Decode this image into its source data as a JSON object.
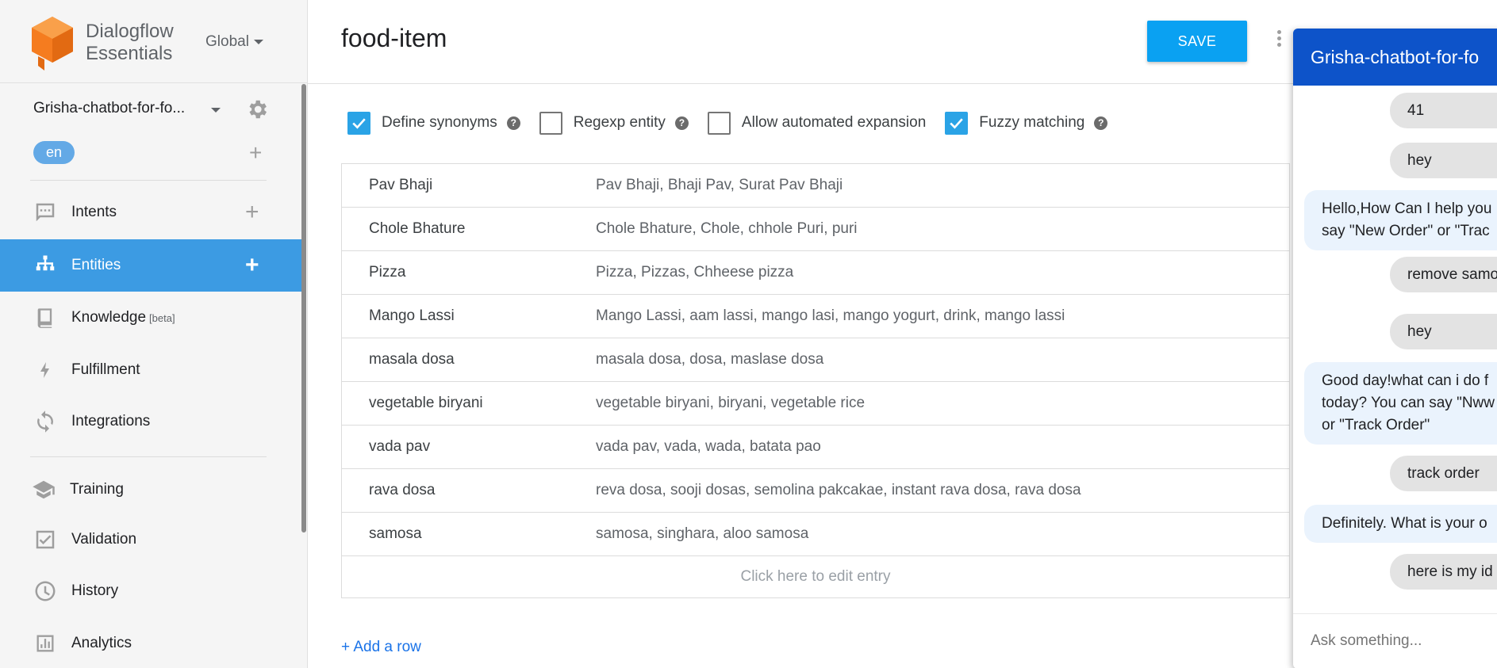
{
  "brand": {
    "name_line1": "Dialogflow",
    "name_line2": "Essentials",
    "region": "Global"
  },
  "agent": {
    "name": "Grisha-chatbot-for-fo...",
    "language": "en"
  },
  "nav": {
    "intents": "Intents",
    "entities": "Entities",
    "knowledge": "Knowledge",
    "knowledge_badge": "[beta]",
    "fulfillment": "Fulfillment",
    "integrations": "Integrations",
    "training": "Training",
    "validation": "Validation",
    "history": "History",
    "analytics": "Analytics"
  },
  "entity": {
    "title": "food-item",
    "save_label": "SAVE",
    "options": {
      "define_synonyms": {
        "label": "Define synonyms",
        "checked": true
      },
      "regexp_entity": {
        "label": "Regexp entity",
        "checked": false
      },
      "automated_expansion": {
        "label": "Allow automated expansion",
        "checked": false
      },
      "fuzzy_matching": {
        "label": "Fuzzy matching",
        "checked": true
      }
    },
    "rows": [
      {
        "value": "Pav Bhaji",
        "synonyms": "Pav Bhaji, Bhaji Pav, Surat Pav Bhaji"
      },
      {
        "value": "Chole Bhature",
        "synonyms": "Chole Bhature, Chole, chhole Puri, puri"
      },
      {
        "value": "Pizza",
        "synonyms": "Pizza, Pizzas, Chheese pizza"
      },
      {
        "value": "Mango Lassi",
        "synonyms": "Mango Lassi, aam lassi, mango lasi, mango yogurt, drink, mango lassi"
      },
      {
        "value": "masala dosa",
        "synonyms": "masala dosa, dosa, maslase dosa"
      },
      {
        "value": "vegetable biryani",
        "synonyms": "vegetable biryani, biryani, vegetable rice"
      },
      {
        "value": "vada pav",
        "synonyms": "vada pav, vada, wada, batata pao"
      },
      {
        "value": "rava dosa",
        "synonyms": "reva dosa, sooji dosas, semolina pakcakae, instant rava dosa, rava dosa"
      },
      {
        "value": "samosa",
        "synonyms": "samosa, singhara, aloo samosa"
      }
    ],
    "edit_hint": "Click here to edit entry",
    "add_row": "+ Add a row"
  },
  "chat": {
    "title": "Grisha-chatbot-for-fo",
    "messages": [
      {
        "from": "user",
        "text": "41"
      },
      {
        "from": "user",
        "text": "hey"
      },
      {
        "from": "bot",
        "text": "Hello,How Can I help you\nsay \"New Order\" or \"Trac"
      },
      {
        "from": "user",
        "text": "remove samo"
      },
      {
        "from": "user",
        "text": "hey"
      },
      {
        "from": "bot",
        "text": "Good day!what can i do f\ntoday? You can say \"Nww\nor \"Track Order\""
      },
      {
        "from": "user",
        "text": "track order"
      },
      {
        "from": "bot",
        "text": "Definitely. What is your o"
      },
      {
        "from": "user",
        "text": "here is my id"
      }
    ],
    "input_placeholder": "Ask something..."
  },
  "colors": {
    "accent": "#0aa1f2",
    "active_nav": "#3c9be3",
    "chat_header": "#0d53c9",
    "logo": "#f57c1f"
  }
}
